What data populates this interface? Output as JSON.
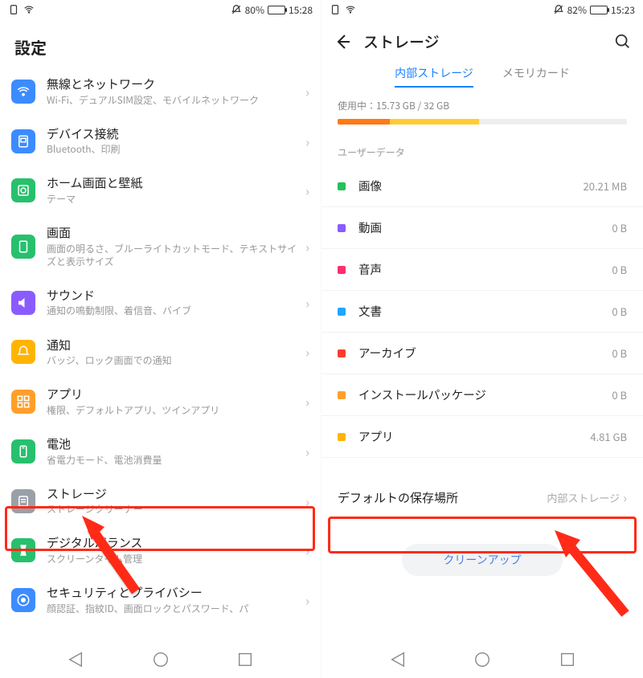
{
  "left": {
    "status": {
      "battery_pct": "80%",
      "time": "15:28"
    },
    "header": "設定",
    "items": [
      {
        "title": "無線とネットワーク",
        "subtitle": "Wi-Fi、デュアルSIM設定、モバイルネットワーク",
        "color": "#3c8cff"
      },
      {
        "title": "デバイス接続",
        "subtitle": "Bluetooth、印刷",
        "color": "#3c8cff"
      },
      {
        "title": "ホーム画面と壁紙",
        "subtitle": "テーマ",
        "color": "#27c06d"
      },
      {
        "title": "画面",
        "subtitle": "画面の明るさ、ブルーライトカットモード、テキストサイズと表示サイズ",
        "color": "#27c06d"
      },
      {
        "title": "サウンド",
        "subtitle": "通知の鳴動制限、着信音、バイブ",
        "color": "#8a5cff"
      },
      {
        "title": "通知",
        "subtitle": "バッジ、ロック画面での通知",
        "color": "#ffb400"
      },
      {
        "title": "アプリ",
        "subtitle": "権限、デフォルトアプリ、ツインアプリ",
        "color": "#ff9f2a"
      },
      {
        "title": "電池",
        "subtitle": "省電力モード、電池消費量",
        "color": "#27c06d"
      },
      {
        "title": "ストレージ",
        "subtitle": "ストレージクリーナー",
        "color": "#9aa0a7"
      },
      {
        "title": "デジタルバランス",
        "subtitle": "スクリーンタイム管理",
        "color": "#27c06d"
      },
      {
        "title": "セキュリティとプライバシー",
        "subtitle": "顔認証、指紋ID、画面ロックとパスワード、パ",
        "color": "#3c8cff"
      }
    ]
  },
  "right": {
    "status": {
      "battery_pct": "82%",
      "time": "15:23"
    },
    "header": "ストレージ",
    "tabs": {
      "active": "内部ストレージ",
      "other": "メモリカード"
    },
    "usage_prefix": "使用中：",
    "usage_used": "15.73 GB",
    "usage_sep": " / ",
    "usage_total": "32 GB",
    "segments": [
      {
        "pct": 18,
        "color": "#ff7a18"
      },
      {
        "pct": 31,
        "color": "#ffcc33"
      }
    ],
    "section_label": "ユーザーデータ",
    "rows": [
      {
        "label": "画像",
        "value": "20.21 MB",
        "color": "#25c05a"
      },
      {
        "label": "動画",
        "value": "0 B",
        "color": "#8a5cff"
      },
      {
        "label": "音声",
        "value": "0 B",
        "color": "#ff2e6a"
      },
      {
        "label": "文書",
        "value": "0 B",
        "color": "#1fa6ff"
      },
      {
        "label": "アーカイブ",
        "value": "0 B",
        "color": "#ff3b30"
      },
      {
        "label": "インストールパッケージ",
        "value": "0 B",
        "color": "#ff9f2a"
      },
      {
        "label": "アプリ",
        "value": "4.81 GB",
        "color": "#ffb400"
      }
    ],
    "default_location": {
      "label": "デフォルトの保存場所",
      "value": "内部ストレージ"
    },
    "cleanup": "クリーンアップ"
  }
}
